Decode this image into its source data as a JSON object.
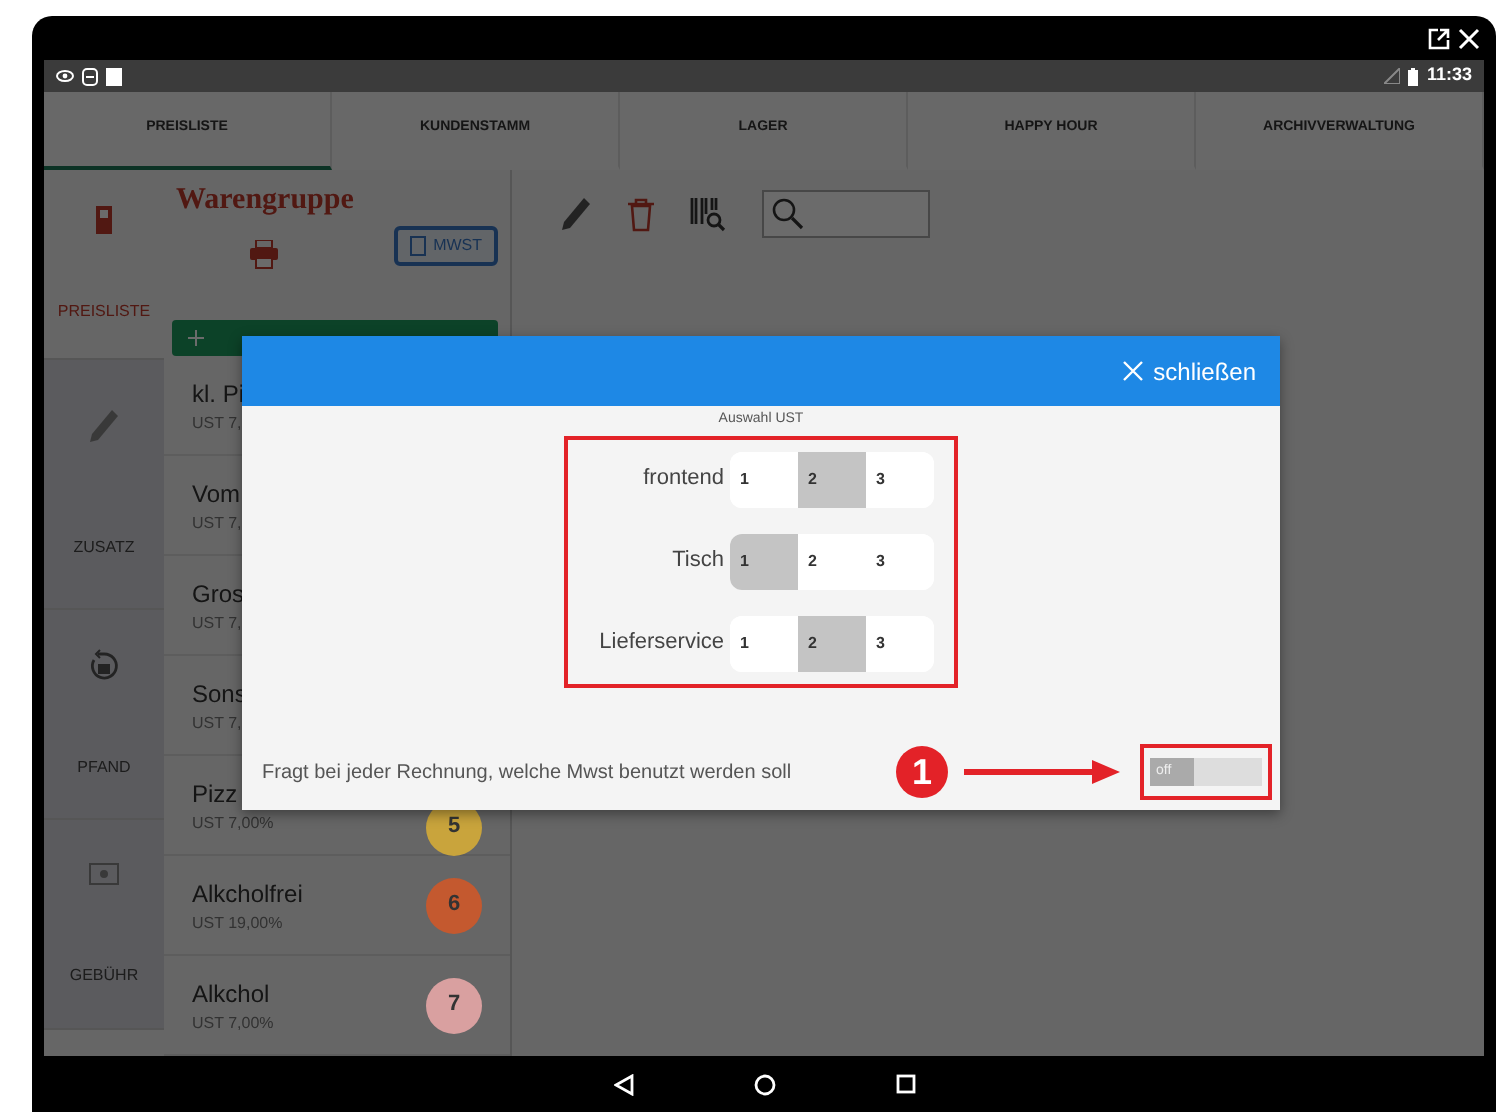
{
  "status_bar": {
    "time": "11:33"
  },
  "tabs": [
    {
      "label": "PREISLISTE",
      "selected": true
    },
    {
      "label": "KUNDENSTAMM",
      "selected": false
    },
    {
      "label": "LAGER",
      "selected": false
    },
    {
      "label": "HAPPY HOUR",
      "selected": false
    },
    {
      "label": "ARCHIVVERWALTUNG",
      "selected": false
    }
  ],
  "sidebar": {
    "items": [
      {
        "label": "PREISLISTE",
        "selected": true,
        "kind": "list"
      },
      {
        "label": "ZUSATZ",
        "selected": false,
        "kind": "pencil"
      },
      {
        "label": "PFAND",
        "selected": false,
        "kind": "refund"
      },
      {
        "label": "GEBÜHR",
        "selected": false,
        "kind": "fee"
      }
    ]
  },
  "group_panel": {
    "title": "Warengruppe",
    "mwst_button": "MWST",
    "items": [
      {
        "name": "kl. Pi",
        "tax": "UST 7,"
      },
      {
        "name": "Vom",
        "tax": "UST 7,"
      },
      {
        "name": "Gros",
        "tax": "UST 7,"
      },
      {
        "name": "Sons",
        "tax": "UST 7,"
      },
      {
        "name": "Pizz",
        "tax": "UST 7,00%",
        "number": "5",
        "color": "#c9a43c"
      },
      {
        "name": "Alkcholfrei",
        "tax": "UST 19,00%",
        "number": "6",
        "color": "#c4592f"
      },
      {
        "name": "Alkchol",
        "tax": "UST 7,00%",
        "number": "7",
        "color": "#d9a0a0"
      }
    ]
  },
  "dialog": {
    "close_label": "schließen",
    "heading": "Auswahl UST",
    "rows": [
      {
        "label": "frontend",
        "options": [
          {
            "label": "1",
            "selected": false
          },
          {
            "label": "2",
            "selected": true
          },
          {
            "label": "3",
            "selected": false
          }
        ]
      },
      {
        "label": "Tisch",
        "options": [
          {
            "label": "1",
            "selected": true
          },
          {
            "label": "2",
            "selected": false
          },
          {
            "label": "3",
            "selected": false
          }
        ]
      },
      {
        "label": "Lieferservice",
        "options": [
          {
            "label": "1",
            "selected": false
          },
          {
            "label": "2",
            "selected": true
          },
          {
            "label": "3",
            "selected": false
          }
        ]
      }
    ],
    "ask_text": "Fragt bei jeder Rechnung, welche Mwst benutzt werden soll",
    "callout": "1",
    "toggle": {
      "label": "off",
      "on": false
    }
  }
}
